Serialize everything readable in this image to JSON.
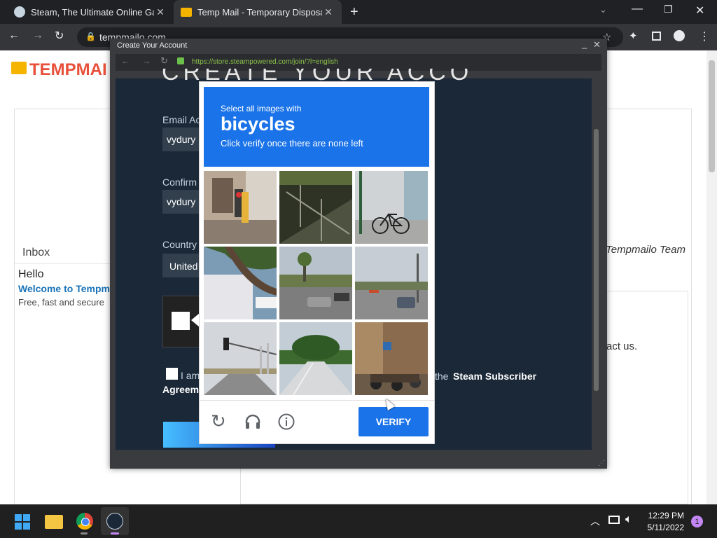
{
  "browser": {
    "tabs": [
      {
        "title": "Steam, The Ultimate Online Gam",
        "active": false
      },
      {
        "title": "Temp Mail - Temporary Disposab",
        "active": true
      }
    ],
    "address": "tempmailo.com"
  },
  "tempmail": {
    "logo": "TEMPMAI",
    "inbox_label": "Inbox",
    "team_label": "Tempmailo Team",
    "message": {
      "from": "Hello",
      "subject": "Welcome to Tempma",
      "preview": "Free, fast and secure"
    },
    "contact_fragment": "act us."
  },
  "popup": {
    "window_title": "Create Your Account",
    "url": "https://store.steampowered.com/join/?l=english",
    "heading_fragment": "CREATE YOUR ACCOUNT",
    "email_label": "Email Ac",
    "email_value": "vydury",
    "confirm_label": "Confirm",
    "confirm_value": "vydury",
    "country_label": "Country",
    "country_value": "United",
    "agree_prefix": "I am",
    "agree_mid": "the",
    "agree_link": "Steam Subscriber",
    "agree_link2": "Agreem"
  },
  "captcha": {
    "instruction": "Select all images with",
    "target": "bicycles",
    "subtitle": "Click verify once there are none left",
    "verify_label": "VERIFY",
    "tiles": [
      {
        "scene": "traffic-light-building"
      },
      {
        "scene": "stairs-railing"
      },
      {
        "scene": "bicycle-storefront"
      },
      {
        "scene": "tree-houses"
      },
      {
        "scene": "street-cars"
      },
      {
        "scene": "city-street"
      },
      {
        "scene": "traffic-signal-road"
      },
      {
        "scene": "park-road"
      },
      {
        "scene": "motorcycles-street"
      }
    ]
  },
  "taskbar": {
    "time": "12:29 PM",
    "date": "5/11/2022",
    "notification_count": "1"
  },
  "colors": {
    "captcha_blue": "#1a73e8",
    "steam_dark": "#1b2838",
    "chrome_dark": "#202124"
  }
}
